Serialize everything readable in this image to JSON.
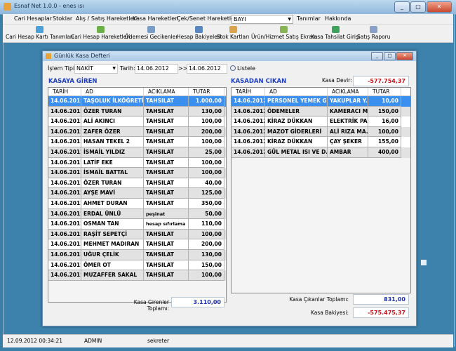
{
  "app": {
    "title": "Esnaf Net 1.0.0 - enes ısı",
    "window_buttons": [
      "_",
      "□",
      "✕"
    ]
  },
  "menu": {
    "items": [
      "Cari Hesaplar",
      "Stoklar",
      "Alış / Satış Hareketleri",
      "Kasa Hareketleri",
      "Çek/Senet Hareketleri"
    ],
    "combo_value": "BAYI",
    "items_right": [
      "Tanımlar",
      "Hakkında"
    ]
  },
  "toolbar": {
    "items": [
      "Cari Hesap Kartı Tanımları",
      "Cari Hesap Hareketleri",
      "Ödemesi Gecikenler",
      "Hesap Bakiyeleri",
      "Stok Kartları",
      "Ürün/Hizmet Satış Ekranı",
      "Kasa Tahsilat Girişi",
      "Satış Raporu"
    ]
  },
  "kasa_window": {
    "title": "Günlük Kasa Defteri",
    "filter": {
      "islem_tipi_label": "İşlem Tipi:",
      "islem_tipi_value": "NAKİT",
      "tarih_label": "Tarih:",
      "tarih_from": "14.06.2012",
      "range_sep": ">>",
      "tarih_to": "14.06.2012",
      "listele_label": "Listele"
    },
    "left": {
      "title": "KASAYA GİREN",
      "columns": [
        "TARİH",
        "AD",
        "ACIKLAMA",
        "TUTAR"
      ],
      "rows": [
        [
          "14.06.2012",
          "TAŞOLUK İLKÖĞRETİ...",
          "TAHSILAT",
          "1.000,00"
        ],
        [
          "14.06.2012",
          "ÖZER TURAN",
          "TAHSILAT",
          "130,00"
        ],
        [
          "14.06.2012",
          "ALİ AKINCI",
          "TAHSILAT",
          "100,00"
        ],
        [
          "14.06.2012",
          "ZAFER ÖZER",
          "TAHSILAT",
          "200,00"
        ],
        [
          "14.06.2012",
          "HASAN TEKEL 2",
          "TAHSILAT",
          "100,00"
        ],
        [
          "14.06.2012",
          "İSMAİL YILDIZ",
          "TAHSILAT",
          "25,00"
        ],
        [
          "14.06.2012",
          "LATİF EKE",
          "TAHSILAT",
          "100,00"
        ],
        [
          "14.06.2012",
          "İSMAİL BATTAL",
          "TAHSILAT",
          "100,00"
        ],
        [
          "14.06.2012",
          "ÖZER TURAN",
          "TAHSILAT",
          "40,00"
        ],
        [
          "14.06.2012",
          "AYŞE MAVİ",
          "TAHSILAT",
          "125,00"
        ],
        [
          "14.06.2012",
          "AHMET DURAN",
          "TAHSILAT",
          "350,00"
        ],
        [
          "14.06.2012",
          "ERDAL ÜNLÜ",
          "peşinat",
          "50,00"
        ],
        [
          "14.06.2012",
          "OSMAN TAN",
          "hesap sıfırlama",
          "110,00"
        ],
        [
          "14.06.2012",
          "RAŞİT SEPETÇİ",
          "TAHSILAT",
          "100,00"
        ],
        [
          "14.06.2012",
          "MEHMET MADIRAN",
          "TAHSILAT",
          "200,00"
        ],
        [
          "14.06.2012",
          "UĞUR ÇELİK",
          "TAHSILAT",
          "130,00"
        ],
        [
          "14.06.2012",
          "ÖMER OT",
          "TAHSILAT",
          "150,00"
        ],
        [
          "14.06.2012",
          "MUZAFFER SAKAL",
          "TAHSILAT",
          "100,00"
        ]
      ],
      "total_label": "Kasa Girenler Toplamı:",
      "total_value": "3.110,00"
    },
    "right": {
      "title": "KASADAN CIKAN",
      "devir_label": "Kasa Devir:",
      "devir_value": "-577.754,37",
      "columns": [
        "TARİH",
        "AD",
        "ACIKLAMA",
        "TUTAR"
      ],
      "rows": [
        [
          "14.06.2012",
          "PERSONEL YEMEK Gİ...",
          "YAKUPLAR Y...",
          "10,00"
        ],
        [
          "14.06.2012",
          "ÖDEMELER",
          "KAMERACI M...",
          "150,00"
        ],
        [
          "14.06.2012",
          "KİRAZ DÜKKAN",
          "ELEKTRİK PA...",
          "16,00"
        ],
        [
          "14.06.2012",
          "MAZOT GİDERLERİ",
          "ALİ RIZA MA...",
          "100,00"
        ],
        [
          "14.06.2012",
          "KİRAZ DÜKKAN",
          "ÇAY ŞEKER",
          "155,00"
        ],
        [
          "14.06.2012",
          "GÜL METAL ISI VE D...",
          "AMBAR",
          "400,00"
        ]
      ],
      "total_label": "Kasa Çıkanlar Toplamı:",
      "total_value": "831,00",
      "balance_label": "Kasa Bakiyesi:",
      "balance_value": "-575.475,37"
    }
  },
  "status": {
    "datetime": "12.09.2012 00:34:21",
    "user": "ADMIN",
    "role": "sekreter"
  },
  "colors": {
    "selected_row": "#3b8fef",
    "section_title": "#1e3fbf",
    "negative_value": "#c8141c",
    "positive_value": "#1e2fb0"
  }
}
